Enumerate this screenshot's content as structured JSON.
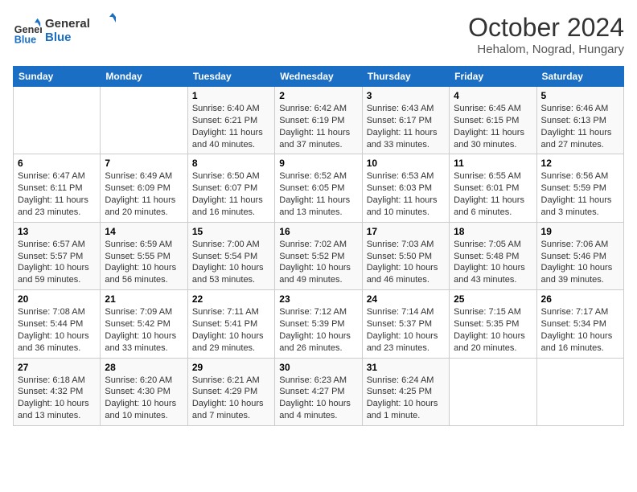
{
  "header": {
    "logo_line1": "General",
    "logo_line2": "Blue",
    "month": "October 2024",
    "location": "Hehalom, Nograd, Hungary"
  },
  "columns": [
    "Sunday",
    "Monday",
    "Tuesday",
    "Wednesday",
    "Thursday",
    "Friday",
    "Saturday"
  ],
  "weeks": [
    [
      {
        "day": "",
        "info": ""
      },
      {
        "day": "",
        "info": ""
      },
      {
        "day": "1",
        "info": "Sunrise: 6:40 AM\nSunset: 6:21 PM\nDaylight: 11 hours and 40 minutes."
      },
      {
        "day": "2",
        "info": "Sunrise: 6:42 AM\nSunset: 6:19 PM\nDaylight: 11 hours and 37 minutes."
      },
      {
        "day": "3",
        "info": "Sunrise: 6:43 AM\nSunset: 6:17 PM\nDaylight: 11 hours and 33 minutes."
      },
      {
        "day": "4",
        "info": "Sunrise: 6:45 AM\nSunset: 6:15 PM\nDaylight: 11 hours and 30 minutes."
      },
      {
        "day": "5",
        "info": "Sunrise: 6:46 AM\nSunset: 6:13 PM\nDaylight: 11 hours and 27 minutes."
      }
    ],
    [
      {
        "day": "6",
        "info": "Sunrise: 6:47 AM\nSunset: 6:11 PM\nDaylight: 11 hours and 23 minutes."
      },
      {
        "day": "7",
        "info": "Sunrise: 6:49 AM\nSunset: 6:09 PM\nDaylight: 11 hours and 20 minutes."
      },
      {
        "day": "8",
        "info": "Sunrise: 6:50 AM\nSunset: 6:07 PM\nDaylight: 11 hours and 16 minutes."
      },
      {
        "day": "9",
        "info": "Sunrise: 6:52 AM\nSunset: 6:05 PM\nDaylight: 11 hours and 13 minutes."
      },
      {
        "day": "10",
        "info": "Sunrise: 6:53 AM\nSunset: 6:03 PM\nDaylight: 11 hours and 10 minutes."
      },
      {
        "day": "11",
        "info": "Sunrise: 6:55 AM\nSunset: 6:01 PM\nDaylight: 11 hours and 6 minutes."
      },
      {
        "day": "12",
        "info": "Sunrise: 6:56 AM\nSunset: 5:59 PM\nDaylight: 11 hours and 3 minutes."
      }
    ],
    [
      {
        "day": "13",
        "info": "Sunrise: 6:57 AM\nSunset: 5:57 PM\nDaylight: 10 hours and 59 minutes."
      },
      {
        "day": "14",
        "info": "Sunrise: 6:59 AM\nSunset: 5:55 PM\nDaylight: 10 hours and 56 minutes."
      },
      {
        "day": "15",
        "info": "Sunrise: 7:00 AM\nSunset: 5:54 PM\nDaylight: 10 hours and 53 minutes."
      },
      {
        "day": "16",
        "info": "Sunrise: 7:02 AM\nSunset: 5:52 PM\nDaylight: 10 hours and 49 minutes."
      },
      {
        "day": "17",
        "info": "Sunrise: 7:03 AM\nSunset: 5:50 PM\nDaylight: 10 hours and 46 minutes."
      },
      {
        "day": "18",
        "info": "Sunrise: 7:05 AM\nSunset: 5:48 PM\nDaylight: 10 hours and 43 minutes."
      },
      {
        "day": "19",
        "info": "Sunrise: 7:06 AM\nSunset: 5:46 PM\nDaylight: 10 hours and 39 minutes."
      }
    ],
    [
      {
        "day": "20",
        "info": "Sunrise: 7:08 AM\nSunset: 5:44 PM\nDaylight: 10 hours and 36 minutes."
      },
      {
        "day": "21",
        "info": "Sunrise: 7:09 AM\nSunset: 5:42 PM\nDaylight: 10 hours and 33 minutes."
      },
      {
        "day": "22",
        "info": "Sunrise: 7:11 AM\nSunset: 5:41 PM\nDaylight: 10 hours and 29 minutes."
      },
      {
        "day": "23",
        "info": "Sunrise: 7:12 AM\nSunset: 5:39 PM\nDaylight: 10 hours and 26 minutes."
      },
      {
        "day": "24",
        "info": "Sunrise: 7:14 AM\nSunset: 5:37 PM\nDaylight: 10 hours and 23 minutes."
      },
      {
        "day": "25",
        "info": "Sunrise: 7:15 AM\nSunset: 5:35 PM\nDaylight: 10 hours and 20 minutes."
      },
      {
        "day": "26",
        "info": "Sunrise: 7:17 AM\nSunset: 5:34 PM\nDaylight: 10 hours and 16 minutes."
      }
    ],
    [
      {
        "day": "27",
        "info": "Sunrise: 6:18 AM\nSunset: 4:32 PM\nDaylight: 10 hours and 13 minutes."
      },
      {
        "day": "28",
        "info": "Sunrise: 6:20 AM\nSunset: 4:30 PM\nDaylight: 10 hours and 10 minutes."
      },
      {
        "day": "29",
        "info": "Sunrise: 6:21 AM\nSunset: 4:29 PM\nDaylight: 10 hours and 7 minutes."
      },
      {
        "day": "30",
        "info": "Sunrise: 6:23 AM\nSunset: 4:27 PM\nDaylight: 10 hours and 4 minutes."
      },
      {
        "day": "31",
        "info": "Sunrise: 6:24 AM\nSunset: 4:25 PM\nDaylight: 10 hours and 1 minute."
      },
      {
        "day": "",
        "info": ""
      },
      {
        "day": "",
        "info": ""
      }
    ]
  ]
}
